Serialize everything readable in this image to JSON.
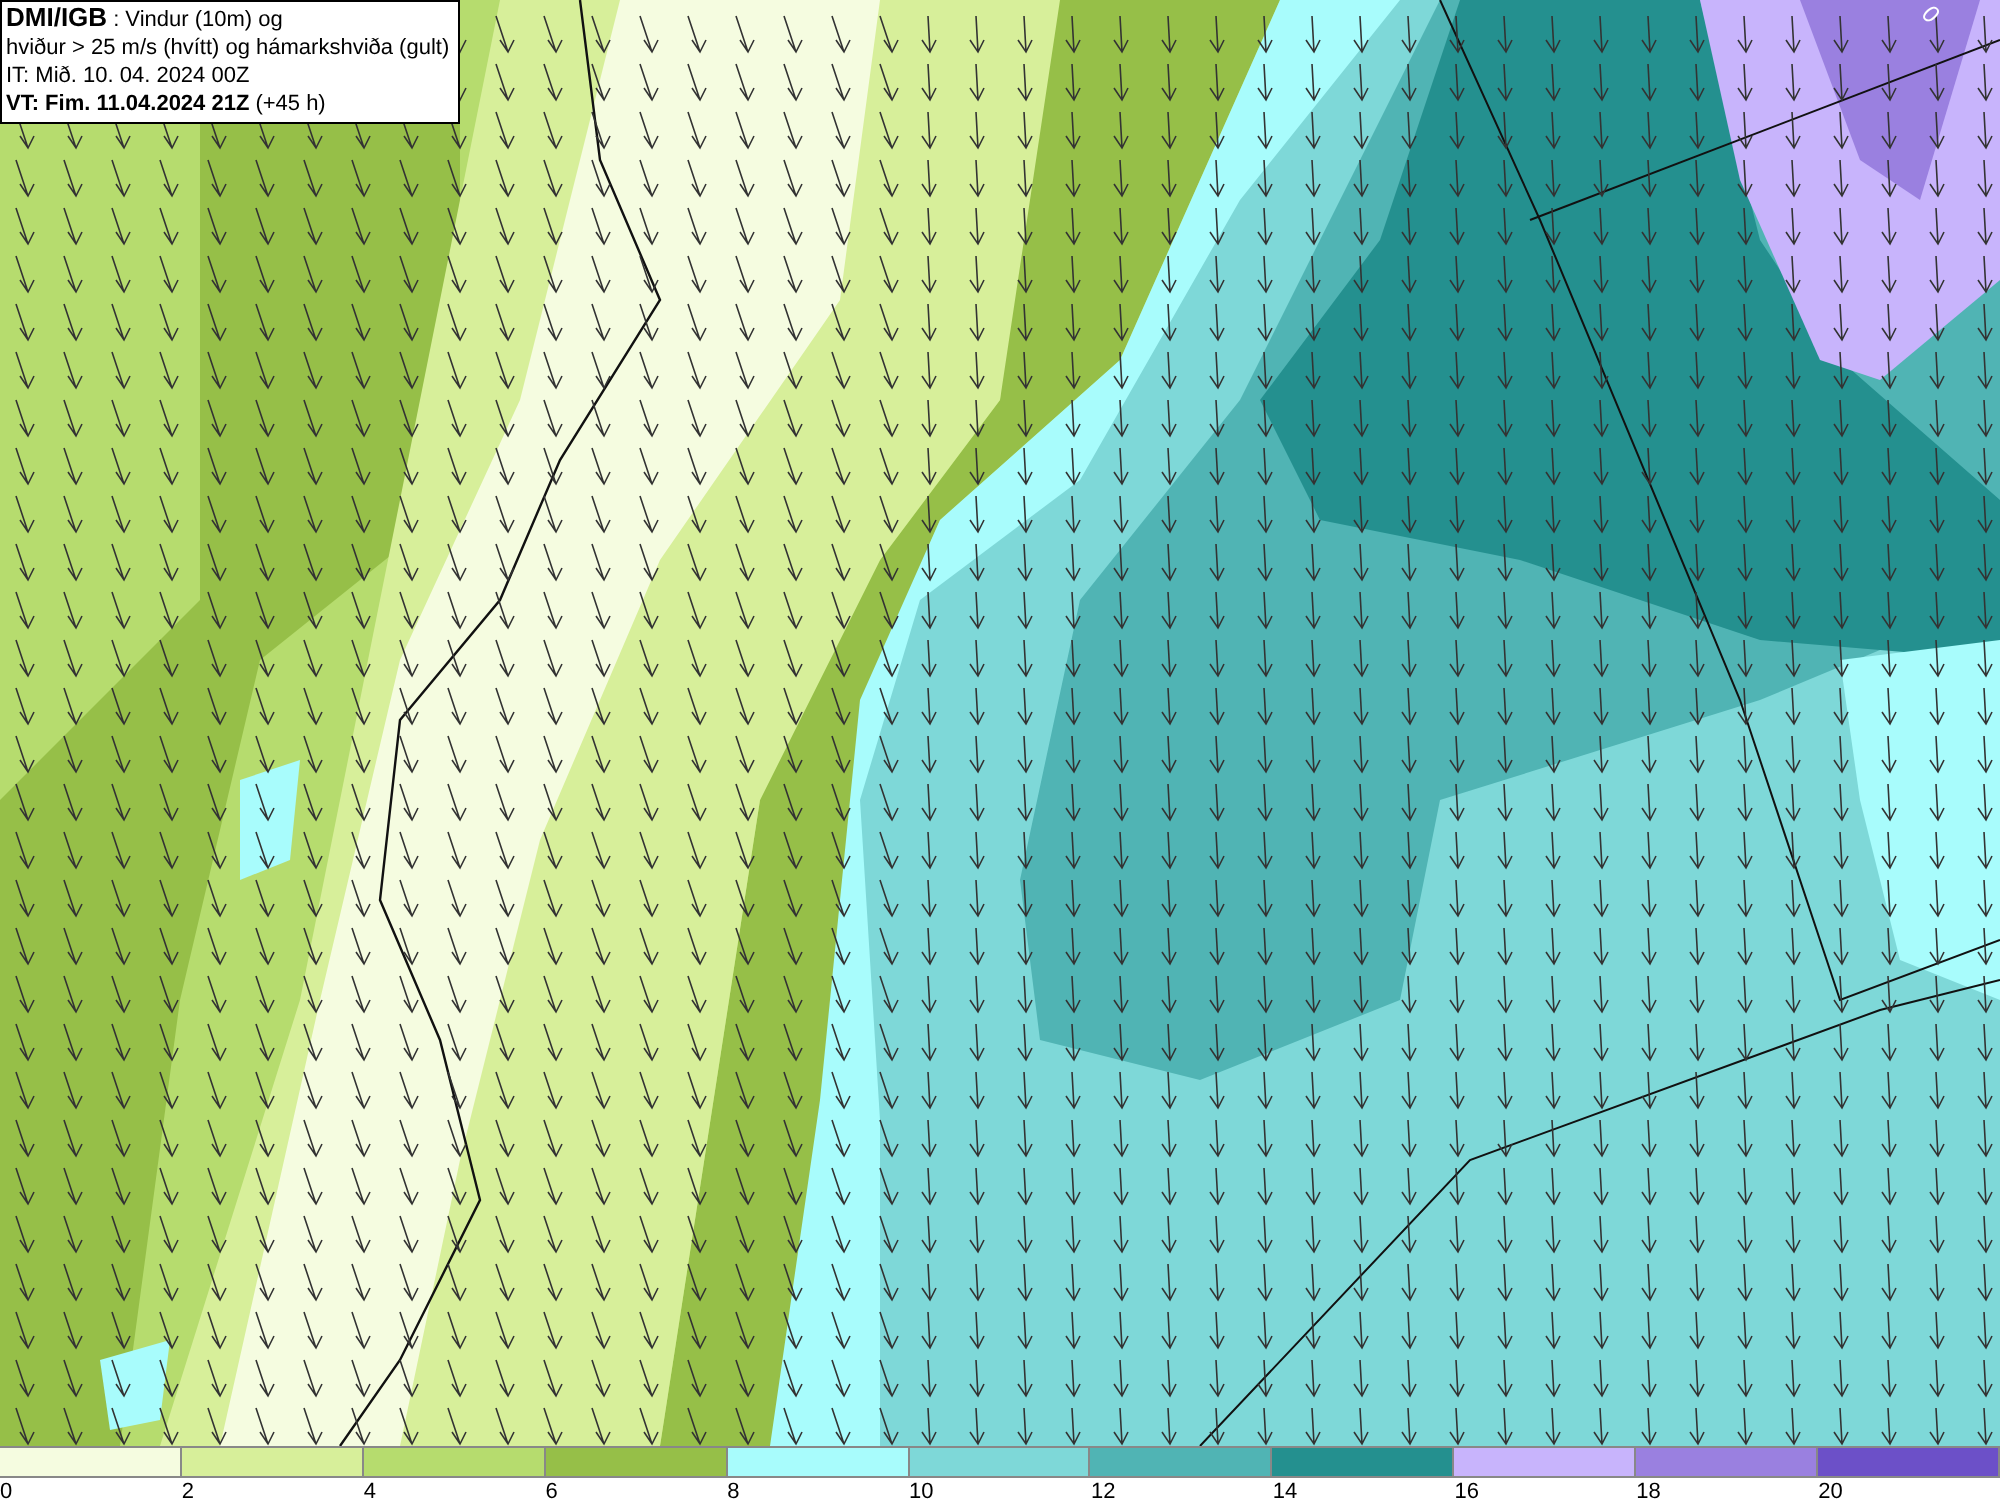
{
  "header": {
    "source": "DMI/IGB",
    "title": ": Vindur (10m) og",
    "subtitle": "hviður > 25 m/s (hvítt) og hámarkshviða (gult)",
    "issue_time": "IT: Mið. 10. 04. 2024 00Z",
    "valid_time": "VT: Fim. 11.04.2024 21Z",
    "lead_time": "(+45 h)"
  },
  "map": {
    "contour_label": "0"
  },
  "legend": [
    {
      "label": "0",
      "color": "#f5fce0"
    },
    {
      "label": "2",
      "color": "#d7ef9a"
    },
    {
      "label": "4",
      "color": "#b6dc6e"
    },
    {
      "label": "6",
      "color": "#96bf48"
    },
    {
      "label": "8",
      "color": "#a8fcfc"
    },
    {
      "label": "10",
      "color": "#7ed8d8"
    },
    {
      "label": "12",
      "color": "#50b4b4"
    },
    {
      "label": "14",
      "color": "#24908f"
    },
    {
      "label": "16",
      "color": "#c8b4fc"
    },
    {
      "label": "18",
      "color": "#9a80e0"
    },
    {
      "label": "20",
      "color": "#6c50c8"
    }
  ]
}
